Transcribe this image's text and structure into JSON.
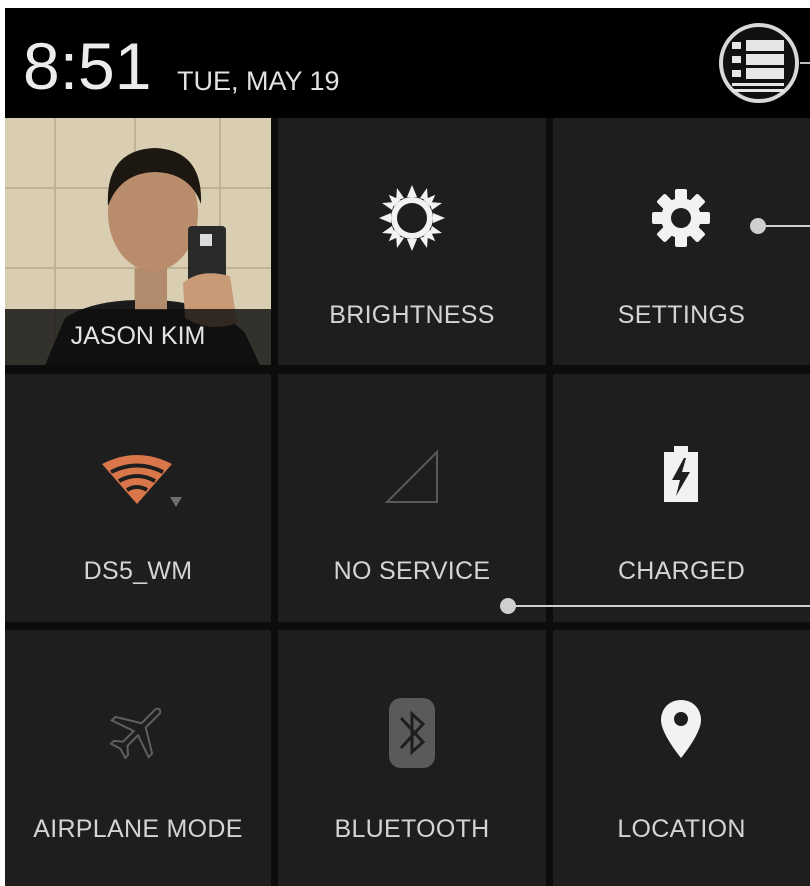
{
  "status_bar": {
    "time": "8:51",
    "date": "TUE, MAY 19",
    "menu_icon": "notification-menu-icon"
  },
  "profile": {
    "name": "JASON KIM"
  },
  "tiles": {
    "brightness": {
      "label": "BRIGHTNESS",
      "icon": "sun-icon"
    },
    "settings": {
      "label": "SETTINGS",
      "icon": "gear-icon"
    },
    "wifi": {
      "label": "DS5_WM",
      "icon": "wifi-icon",
      "color": "#d9774a"
    },
    "cellular": {
      "label": "NO SERVICE",
      "icon": "signal-icon"
    },
    "battery": {
      "label": "CHARGED",
      "icon": "battery-charging-icon"
    },
    "airplane": {
      "label": "AIRPLANE MODE",
      "icon": "airplane-icon"
    },
    "bluetooth": {
      "label": "BLUETOOTH",
      "icon": "bluetooth-icon"
    },
    "location": {
      "label": "LOCATION",
      "icon": "location-pin-icon"
    }
  },
  "colors": {
    "background": "#0c0c0c",
    "tile": "#1e1e1e",
    "text": "#d4d4d4",
    "wifi_accent": "#d9774a"
  }
}
